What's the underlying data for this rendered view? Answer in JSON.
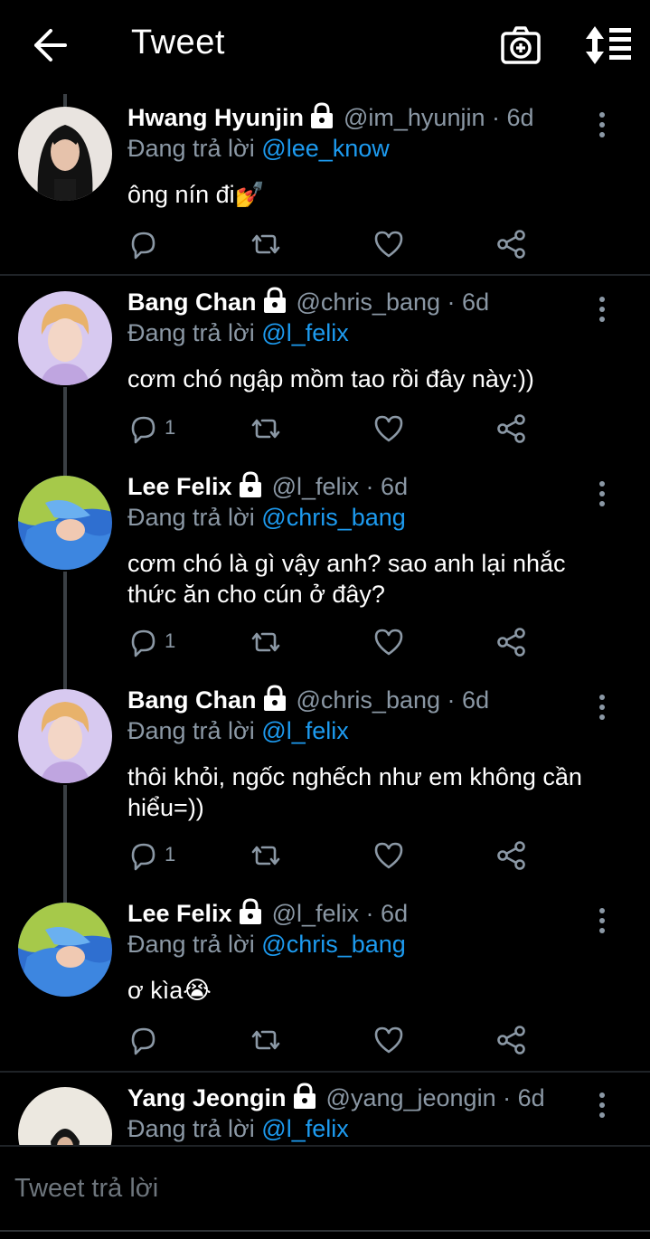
{
  "header": {
    "title": "Tweet"
  },
  "reply_prefix": "Đang trả lời",
  "tweets": [
    {
      "name": "Hwang Hyunjin",
      "handle": "@im_hyunjin",
      "dot": "·",
      "time": "6d",
      "reply_to": "@lee_know",
      "text": "ông nín đi💅",
      "reply_count": "",
      "avatar_color": "#e9e4e0"
    },
    {
      "name": "Bang Chan",
      "handle": "@chris_bang",
      "dot": "·",
      "time": "6d",
      "reply_to": "@l_felix",
      "text": "cơm chó ngập mồm tao rồi đây này:))",
      "reply_count": "1",
      "avatar_color": "#c9b8e8"
    },
    {
      "name": "Lee Felix",
      "handle": "@l_felix",
      "dot": "·",
      "time": "6d",
      "reply_to": "@chris_bang",
      "text": "cơm chó là gì vậy anh? sao anh lại nhắc thức ăn cho cún ở đây?",
      "reply_count": "1",
      "avatar_color": "#3a7bd5"
    },
    {
      "name": "Bang Chan",
      "handle": "@chris_bang",
      "dot": "·",
      "time": "6d",
      "reply_to": "@l_felix",
      "text": "thôi khỏi, ngốc nghếch như em không cần hiểu=))",
      "reply_count": "1",
      "avatar_color": "#c9b8e8"
    },
    {
      "name": "Lee Felix",
      "handle": "@l_felix",
      "dot": "·",
      "time": "6d",
      "reply_to": "@chris_bang",
      "text": "ơ kìa😭",
      "reply_count": "",
      "avatar_color": "#3a7bd5"
    },
    {
      "name": "Yang Jeongin",
      "handle": "@yang_jeongin",
      "dot": "·",
      "time": "6d",
      "reply_to": "@l_felix",
      "text": "",
      "reply_count": "",
      "avatar_color": "#e8e4dc"
    }
  ],
  "composer": {
    "placeholder": "Tweet trả lời"
  },
  "colors": {
    "background": "#000000",
    "muted": "#8b98a5",
    "link": "#1d9bf0"
  },
  "icons": [
    "back-arrow-icon",
    "camera-plus-icon",
    "sort-icon",
    "lock-icon",
    "more-vertical-icon",
    "reply-icon",
    "retweet-icon",
    "like-icon",
    "share-icon"
  ]
}
